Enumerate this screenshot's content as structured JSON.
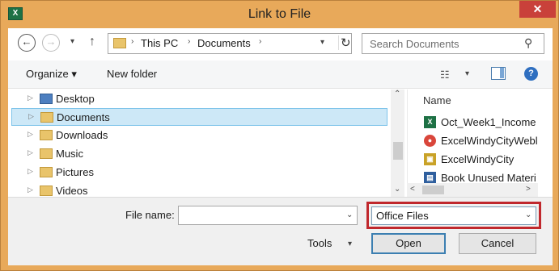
{
  "window": {
    "title": "Link to File",
    "app_icon_text": "X",
    "close_glyph": "✕"
  },
  "nav": {
    "back_glyph": "←",
    "forward_glyph": "→",
    "recent_glyph": "▾",
    "up_glyph": "↑"
  },
  "address": {
    "crumbs": [
      "This PC",
      "Documents"
    ],
    "separator_glyph": "›",
    "dropdown_glyph": "▾",
    "refresh_glyph": "↻"
  },
  "search": {
    "placeholder": "Search Documents",
    "icon_glyph": "⚲"
  },
  "toolbar": {
    "organize_label": "Organize ▾",
    "new_folder_label": "New folder",
    "view_glyph": "☷",
    "view_dropdown_glyph": "▾",
    "help_glyph": "?"
  },
  "tree": {
    "expander_glyph": "▷",
    "items": [
      {
        "label": "Desktop",
        "icon": "desktop-folder-icon",
        "selected": false
      },
      {
        "label": "Documents",
        "icon": "documents-folder-icon",
        "selected": true
      },
      {
        "label": "Downloads",
        "icon": "downloads-folder-icon",
        "selected": false
      },
      {
        "label": "Music",
        "icon": "music-folder-icon",
        "selected": false
      },
      {
        "label": "Pictures",
        "icon": "pictures-folder-icon",
        "selected": false
      },
      {
        "label": "Videos",
        "icon": "videos-folder-icon",
        "selected": false
      }
    ]
  },
  "scroll": {
    "up_glyph": "⌃",
    "down_glyph": "⌄",
    "left_glyph": "<",
    "right_glyph": ">"
  },
  "files": {
    "column_name": "Name",
    "items": [
      {
        "label": "Oct_Week1_Income",
        "icon": "excel-file-icon",
        "icon_text": "X",
        "color": "#1e7145"
      },
      {
        "label": "ExcelWindyCityWebl",
        "icon": "chrome-file-icon",
        "icon_text": "●",
        "color": "#d9463b"
      },
      {
        "label": "ExcelWindyCity",
        "icon": "folder-file-icon",
        "icon_text": "▣",
        "color": "#c9a227"
      },
      {
        "label": "Book Unused Materi",
        "icon": "document-file-icon",
        "icon_text": "▤",
        "color": "#2f5f9e"
      }
    ]
  },
  "bottom": {
    "file_name_label": "File name:",
    "file_name_value": "",
    "file_name_dropdown_glyph": "⌄",
    "filter_value": "Office Files",
    "filter_dropdown_glyph": "⌄",
    "tools_label": "Tools",
    "tools_dropdown_glyph": "▾",
    "open_label": "Open",
    "cancel_label": "Cancel"
  },
  "colors": {
    "title_bar": "#e8a95a",
    "close_button": "#c9413a",
    "selection": "#cde8f7",
    "highlight_outline": "#c0282d"
  }
}
